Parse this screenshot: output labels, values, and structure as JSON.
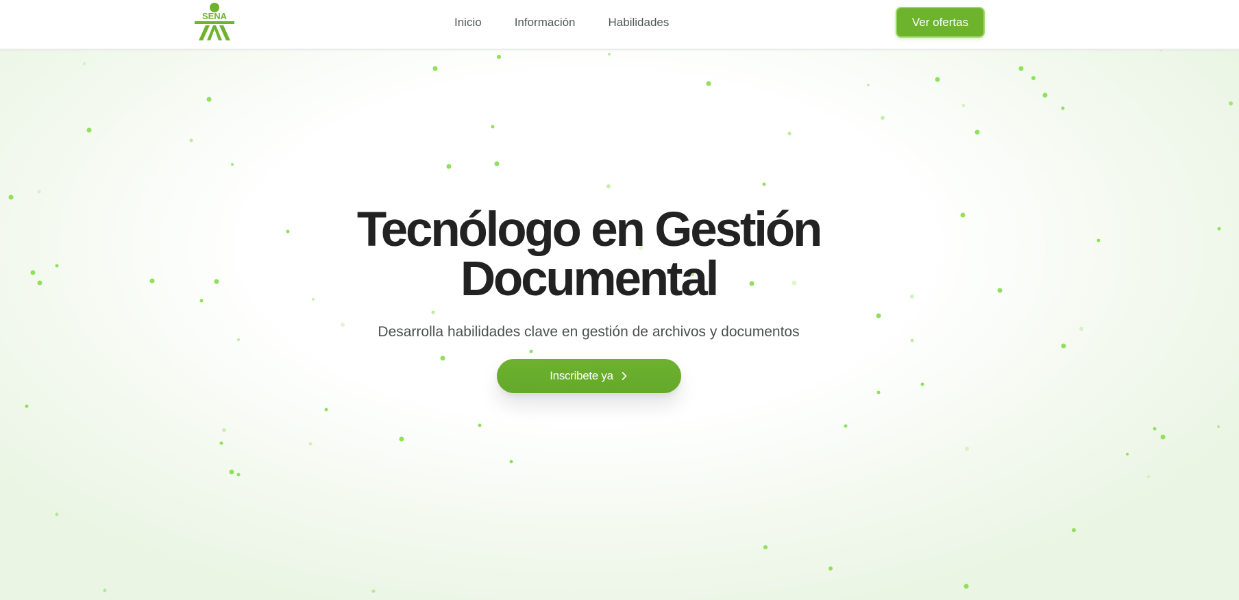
{
  "navbar": {
    "logo_text": "SENA",
    "links": [
      {
        "label": "Inicio"
      },
      {
        "label": "Información"
      },
      {
        "label": "Habilidades"
      }
    ],
    "offers_button": "Ver ofertas"
  },
  "hero": {
    "title_line1": "Tecnólogo en Gestión",
    "title_line2": "Documental",
    "subtitle": "Desarrolla habilidades clave en gestión de archivos y documentos",
    "cta_label": "Inscribete ya",
    "cta_icon": "chevron-right-icon"
  },
  "colors": {
    "brand_green": "#6eb32c",
    "particle_green": "#8fe05a",
    "title": "#222222",
    "text": "#4b4f4d"
  }
}
